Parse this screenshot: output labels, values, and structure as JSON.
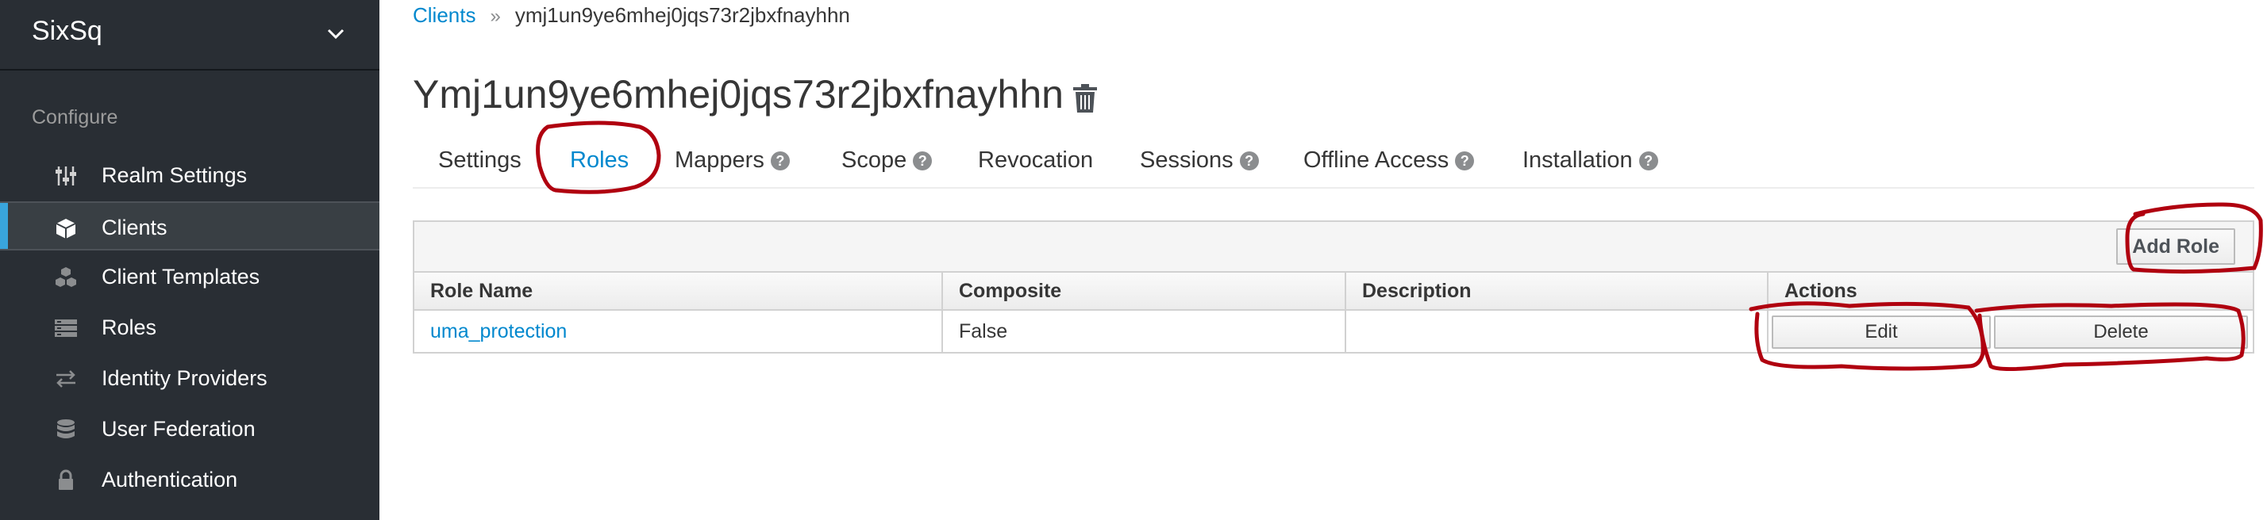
{
  "sidebar": {
    "realm_name": "SixSq",
    "section_label": "Configure",
    "items": [
      {
        "label": "Realm Settings",
        "icon": "sliders-icon",
        "active": false
      },
      {
        "label": "Clients",
        "icon": "cube-icon",
        "active": true
      },
      {
        "label": "Client Templates",
        "icon": "cubes-icon",
        "active": false
      },
      {
        "label": "Roles",
        "icon": "list-icon",
        "active": false
      },
      {
        "label": "Identity Providers",
        "icon": "exchange-icon",
        "active": false
      },
      {
        "label": "User Federation",
        "icon": "database-icon",
        "active": false
      },
      {
        "label": "Authentication",
        "icon": "lock-icon",
        "active": false
      }
    ]
  },
  "breadcrumb": {
    "parent": "Clients",
    "separator": "»",
    "current": "ymj1un9ye6mhej0jqs73r2jbxfnayhhn"
  },
  "page_title": "Ymj1un9ye6mhej0jqs73r2jbxfnayhhn",
  "tabs": [
    {
      "label": "Settings",
      "help": false
    },
    {
      "label": "Roles",
      "help": false,
      "active": true
    },
    {
      "label": "Mappers",
      "help": true
    },
    {
      "label": "Scope",
      "help": true
    },
    {
      "label": "Revocation",
      "help": false
    },
    {
      "label": "Sessions",
      "help": true
    },
    {
      "label": "Offline Access",
      "help": true
    },
    {
      "label": "Installation",
      "help": true
    }
  ],
  "table": {
    "add_button": "Add Role",
    "columns": [
      "Role Name",
      "Composite",
      "Description",
      "Actions"
    ],
    "rows": [
      {
        "role_name": "uma_protection",
        "composite": "False",
        "description": "",
        "edit": "Edit",
        "delete": "Delete"
      }
    ]
  },
  "colors": {
    "sidebar_bg": "#292e34",
    "accent": "#0088ce",
    "annotation": "#b0000f"
  }
}
